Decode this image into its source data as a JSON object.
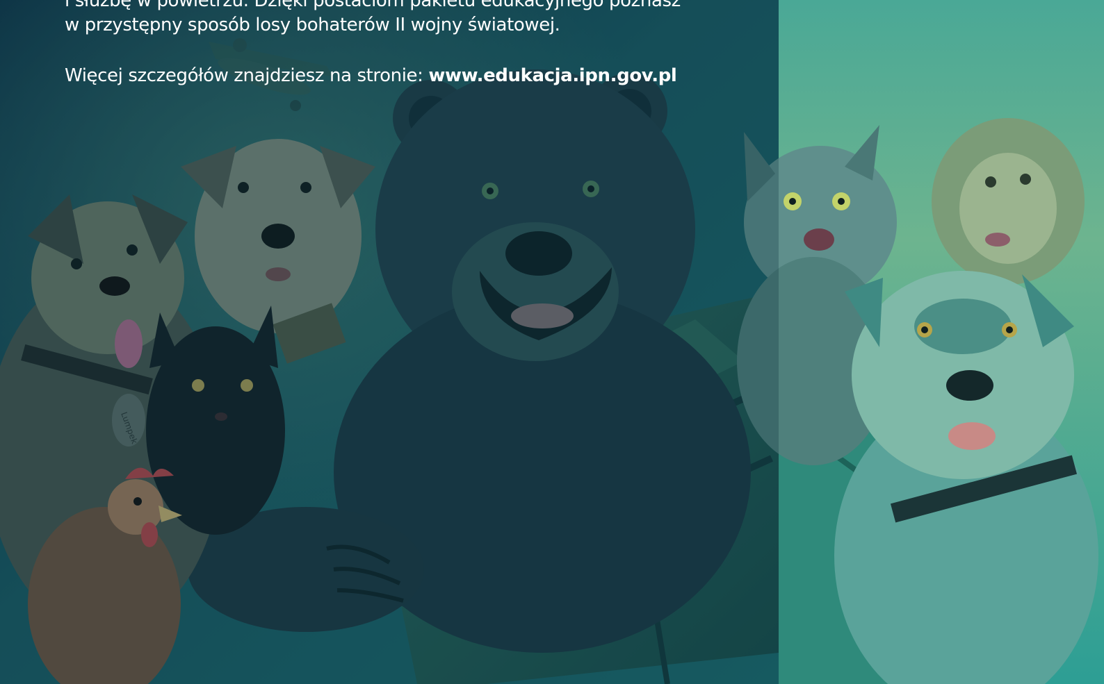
{
  "intro": {
    "line1": "i służbę w powietrzu. Dzięki postaciom pakietu edukacyjnego poznasz",
    "line2": "w przystępny sposób losy bohaterów II wojny światowej."
  },
  "more_info": {
    "prefix": "Więcej szczegółów znajdziesz na stronie: ",
    "url": "www.edukacja.ipn.gov.pl"
  },
  "illustration": {
    "subjects": [
      "bear",
      "dog",
      "dog",
      "cat",
      "cat",
      "rooster",
      "monkey",
      "dog",
      "airplane",
      "crate"
    ],
    "tag_text": "Lumpek",
    "colors": {
      "dark_panel": "#0d3a4c",
      "light_panel": "#2f9e92",
      "text": "#ffffff"
    }
  }
}
